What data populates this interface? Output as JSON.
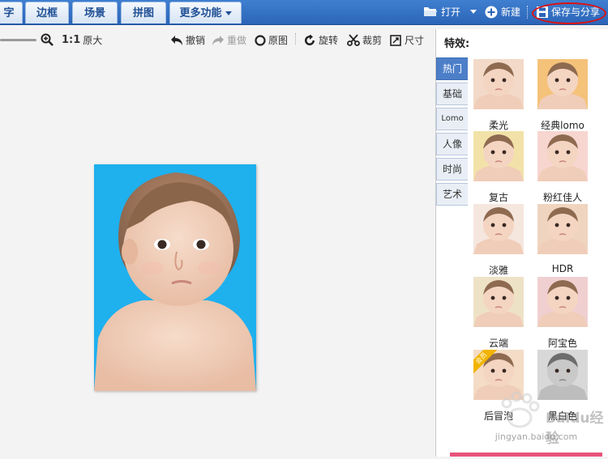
{
  "topbar": {
    "tabs": [
      {
        "label": "字"
      },
      {
        "label": "边框"
      },
      {
        "label": "场景"
      },
      {
        "label": "拼图"
      },
      {
        "label": "更多功能"
      }
    ],
    "open_label": "打开",
    "new_label": "新建",
    "save_label": "保存与分享"
  },
  "toolbar": {
    "ratio_label": "1:1",
    "original_size_label": "原大",
    "undo_label": "撤销",
    "redo_label": "重做",
    "original_label": "原图",
    "rotate_label": "旋转",
    "crop_label": "裁剪",
    "size_label": "尺寸"
  },
  "panel": {
    "title": "特效:",
    "categories": [
      {
        "label": "热门"
      },
      {
        "label": "基础"
      },
      {
        "label": "Lomo"
      },
      {
        "label": "人像"
      },
      {
        "label": "时尚"
      },
      {
        "label": "艺术"
      }
    ],
    "effects": [
      {
        "label": "柔光",
        "tint": "#f3d9c8"
      },
      {
        "label": "经典lomo",
        "tint": "#f5c27a"
      },
      {
        "label": "复古",
        "tint": "#f2e2a8"
      },
      {
        "label": "粉红佳人",
        "tint": "#f7d6d0"
      },
      {
        "label": "淡雅",
        "tint": "#f5e6de"
      },
      {
        "label": "HDR",
        "tint": "#efd4bf"
      },
      {
        "label": "云端",
        "tint": "#eee2c6"
      },
      {
        "label": "阿宝色",
        "tint": "#f0cfd0"
      },
      {
        "label": "后冒泡",
        "tint": "#f4dcc6",
        "badge": "会员"
      },
      {
        "label": "黑白色",
        "tint": "#d8d8d8"
      }
    ]
  },
  "watermark": {
    "brand": "Baidu经验",
    "url": "jingyan.baidu.com"
  },
  "colors": {
    "topbar": "#2f6bbd",
    "accent_active_tab": "#4d7fc9",
    "photo_bg": "#1fb0ee",
    "save_highlight": "#dd1111"
  }
}
